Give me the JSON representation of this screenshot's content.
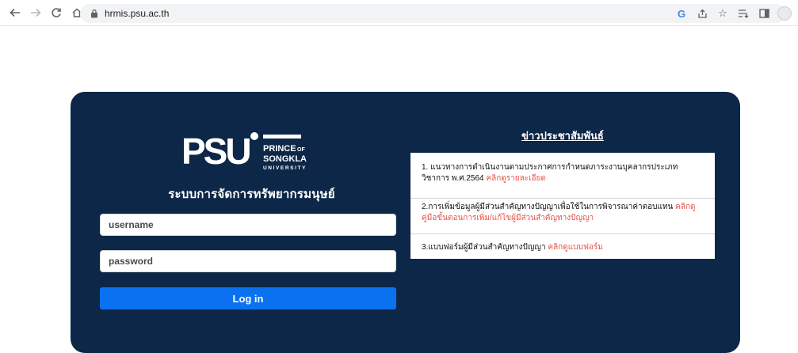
{
  "browser": {
    "url": "hrmis.psu.ac.th",
    "back_icon": "arrow-left-icon",
    "forward_icon": "arrow-right-icon",
    "reload_icon": "reload-icon",
    "home_icon": "home-icon"
  },
  "logo": {
    "mark": "PSU",
    "line1": "PRINCE",
    "line1_suffix": "OF",
    "line2": "SONGKLA",
    "line3": "UNIVERSITY"
  },
  "system_title": "ระบบการจัดการทรัพยากรมนุษย์",
  "login": {
    "username_placeholder": "username",
    "password_placeholder": "password",
    "login_button": "Log in"
  },
  "news": {
    "title": "ข่าวประชาสัมพันธ์",
    "items": [
      {
        "text": "1. แนวทางการดำเนินงานตามประกาศการกำหนดภาระงานบุคลากรประเภทวิชาการ พ.ศ.2564",
        "link": "คลิกดูรายละเอียด"
      },
      {
        "text": "2.การเพิ่มข้อมูลผู้มีส่วนสำคัญทางปัญญาเพื่อใช้ในการพิจารณาค่าตอบแทน",
        "link": "คลิกดูคู่มือขั้นตอนการเพิ่ม/แก้ไขผู้มีส่วนสำคัญทางปัญญา"
      },
      {
        "text": "3.แบบฟอร์มผู้มีส่วนสำคัญทางปัญญา",
        "link": "คลิกดูแบบฟอร์ม"
      }
    ]
  },
  "colors": {
    "card_bg": "#0d2748",
    "button_bg": "#0a72f0",
    "link": "#e8534a"
  }
}
